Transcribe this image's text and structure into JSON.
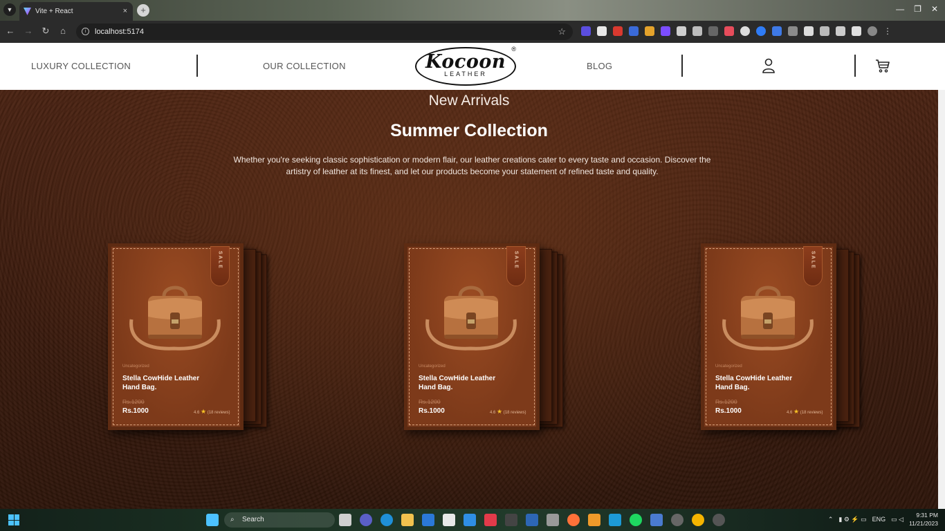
{
  "browser": {
    "tab_title": "Vite + React",
    "tab_close": "×",
    "new_tab": "+",
    "url": "localhost:5174"
  },
  "site": {
    "nav": {
      "luxury": "LUXURY COLLECTION",
      "our_collection": "OUR COLLECTION",
      "blog": "BLOG"
    },
    "logo": {
      "main": "Kocoon",
      "sub": "LEATHER",
      "reg": "®"
    }
  },
  "hero": {
    "eyebrow": "New Arrivals",
    "title": "Summer Collection",
    "description": "Whether you're seeking classic sophistication or modern flair, our leather creations cater to every taste and occasion. Discover the artistry of leather at its finest, and let our products become your statement of refined taste and quality."
  },
  "products": [
    {
      "tag": "SALE",
      "category": "Uncategorized",
      "name": "Stella CowHide Leather Hand Bag.",
      "old_price": "Rs.1200",
      "price": "Rs.1000",
      "rating": "4.6",
      "reviews": "(18 reviews)"
    },
    {
      "tag": "SALE",
      "category": "Uncategorized",
      "name": "Stella CowHide Leather Hand Bag.",
      "old_price": "Rs.1200",
      "price": "Rs.1000",
      "rating": "4.6",
      "reviews": "(18 reviews)"
    },
    {
      "tag": "SALE",
      "category": "Uncategorized",
      "name": "Stella CowHide Leather Hand Bag.",
      "old_price": "Rs.1200",
      "price": "Rs.1000",
      "rating": "4.6",
      "reviews": "(18 reviews)"
    }
  ],
  "taskbar": {
    "search": "Search",
    "lang": "ENG",
    "time": "9:31 PM",
    "date": "11/21/2023"
  },
  "colors": {
    "accent_leather": "#7a3a1c",
    "header_bg": "#ffffff",
    "hero_bg": "#3d1c0e"
  }
}
